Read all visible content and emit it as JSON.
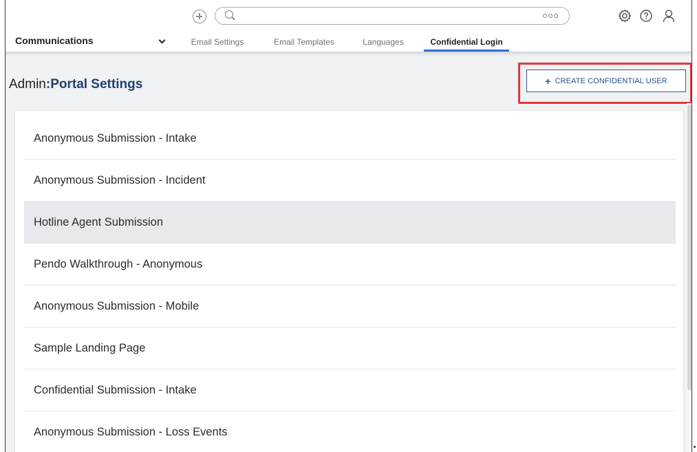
{
  "topbar": {
    "search_placeholder": "",
    "icons": [
      "plus-circle-icon",
      "search-icon",
      "more-icon",
      "gear-icon",
      "help-icon",
      "user-icon"
    ]
  },
  "nav": {
    "module": "Communications",
    "tabs": [
      {
        "label": "Email Settings",
        "active": false
      },
      {
        "label": "Email Templates",
        "active": false
      },
      {
        "label": "Languages",
        "active": false
      },
      {
        "label": "Confidential Login",
        "active": true
      }
    ]
  },
  "header": {
    "title_prefix": "Admin",
    "title_separator": ":",
    "title_main": "Portal Settings",
    "create_button": "CREATE CONFIDENTIAL USER"
  },
  "portals": [
    {
      "label": "Anonymous Submission - Intake"
    },
    {
      "label": "Anonymous Submission - Incident"
    },
    {
      "label": "Hotline Agent Submission"
    },
    {
      "label": "Pendo Walkthrough - Anonymous"
    },
    {
      "label": "Anonymous Submission - Mobile"
    },
    {
      "label": "Sample Landing Page"
    },
    {
      "label": "Confidential Submission - Intake"
    },
    {
      "label": "Anonymous Submission - Loss Events"
    }
  ],
  "colors": {
    "accent": "#2f6fd1",
    "title_blue": "#1f3f6e",
    "highlight_red": "#e0383f",
    "hover_row": "#e8e9ec"
  }
}
